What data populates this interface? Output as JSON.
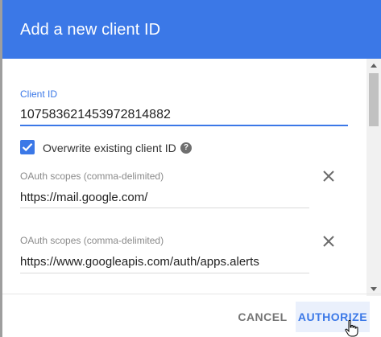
{
  "dialog": {
    "title": "Add a new client ID",
    "client_id_label": "Client ID",
    "client_id_value": "107583621453972814882",
    "overwrite_label": "Overwrite existing client ID",
    "overwrite_checked": true,
    "help_icon_glyph": "?",
    "scopes": [
      {
        "label": "OAuth scopes (comma-delimited)",
        "value": "https://mail.google.com/"
      },
      {
        "label": "OAuth scopes (comma-delimited)",
        "value": "https://www.googleapis.com/auth/apps.alerts"
      }
    ],
    "cancel_label": "CANCEL",
    "authorize_label": "AUTHORIZE"
  },
  "colors": {
    "header": "#3b78e7",
    "accent": "#3b78e7"
  },
  "icons": [
    "check-icon",
    "help-icon",
    "close-icon",
    "hand-pointer-icon"
  ]
}
